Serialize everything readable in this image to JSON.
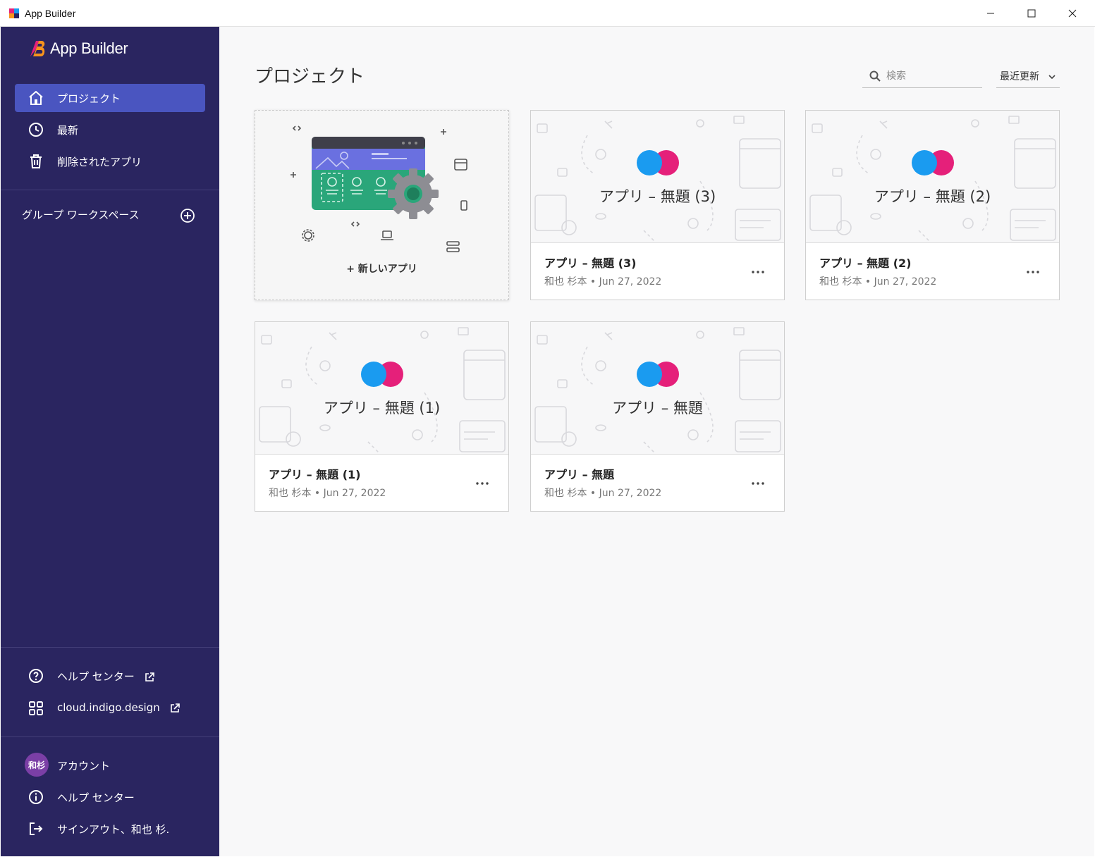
{
  "window": {
    "title": "App Builder",
    "controls": [
      "minimize",
      "maximize",
      "close"
    ]
  },
  "sidebar": {
    "logo_text": "App Builder",
    "nav": [
      {
        "label": "プロジェクト",
        "icon": "home-icon",
        "active": true
      },
      {
        "label": "最新",
        "icon": "clock-icon",
        "active": false
      },
      {
        "label": "削除されたアプリ",
        "icon": "trash-icon",
        "active": false
      }
    ],
    "group_workspace_label": "グループ ワークスペース",
    "links": [
      {
        "label": "ヘルプ センター",
        "icon": "help-circle-icon",
        "external": true
      },
      {
        "label": "cloud.indigo.design",
        "icon": "grid-icon",
        "external": true
      }
    ],
    "account": {
      "avatar_initials": "和杉",
      "avatar_color": "#7b3fa6",
      "account_label": "アカウント",
      "help_label": "ヘルプ センター",
      "signout_label": "サインアウト、和也 杉."
    }
  },
  "main": {
    "title": "プロジェクト",
    "search_placeholder": "検索",
    "sort_label": "最近更新",
    "new_app_label": "+ 新しいアプリ",
    "apps": [
      {
        "thumb_title": "アプリ – 無題 (3)",
        "name": "アプリ – 無題 (3)",
        "author": "和也 杉本",
        "date": "Jun 27, 2022"
      },
      {
        "thumb_title": "アプリ – 無題 (2)",
        "name": "アプリ – 無題 (2)",
        "author": "和也 杉本",
        "date": "Jun 27, 2022"
      },
      {
        "thumb_title": "アプリ – 無題 (1)",
        "name": "アプリ – 無題 (1)",
        "author": "和也 杉本",
        "date": "Jun 27, 2022"
      },
      {
        "thumb_title": "アプリ – 無題",
        "name": "アプリ – 無題",
        "author": "和也 杉本",
        "date": "Jun 27, 2022"
      }
    ]
  },
  "colors": {
    "sidebar_bg": "#2a2560",
    "active_nav": "#4a55c0",
    "circle_blue": "#1a9bf0",
    "circle_pink": "#e5207a"
  }
}
